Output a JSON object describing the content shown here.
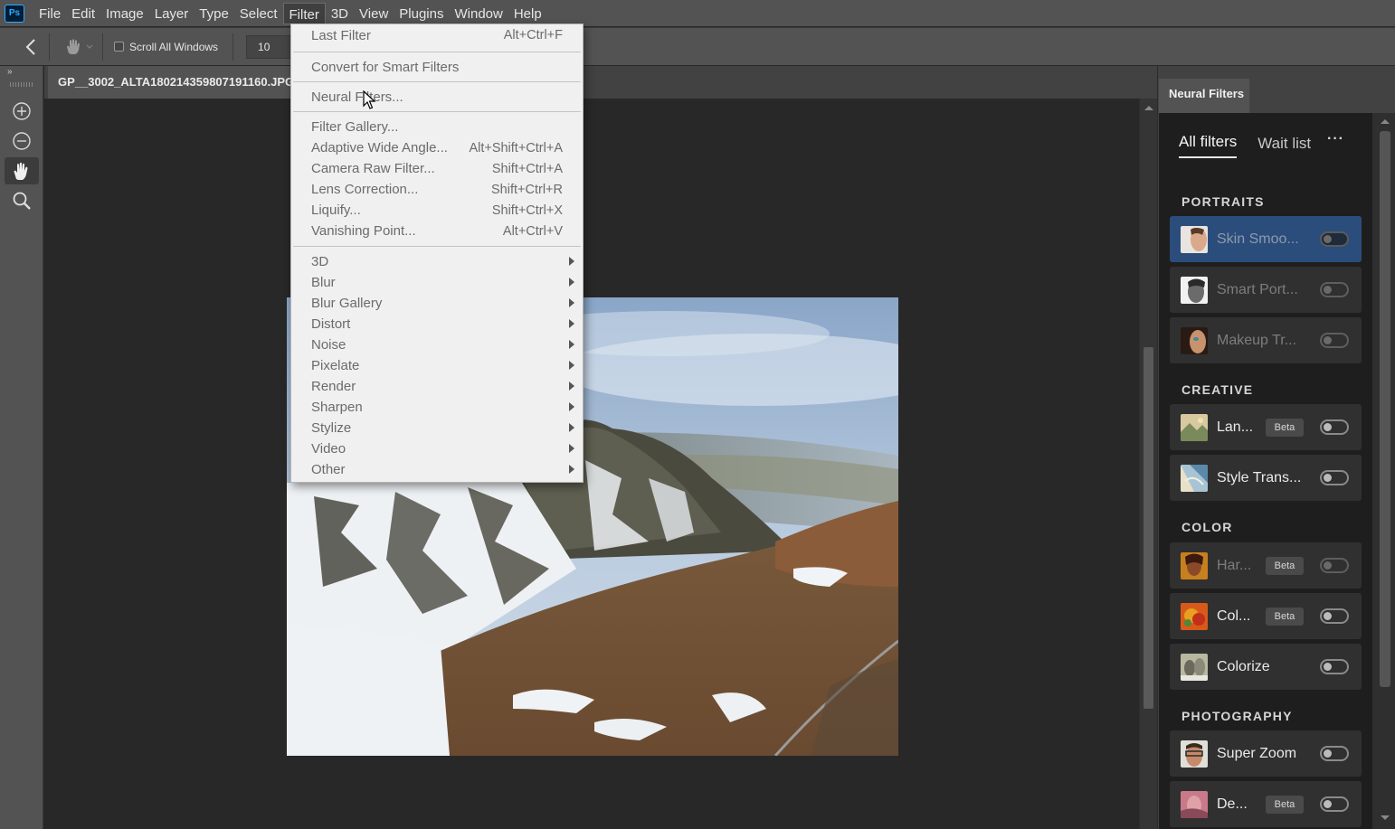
{
  "app": {
    "logo": "Ps"
  },
  "menubar": {
    "items": [
      "File",
      "Edit",
      "Image",
      "Layer",
      "Type",
      "Select",
      "Filter",
      "3D",
      "View",
      "Plugins",
      "Window",
      "Help"
    ]
  },
  "options": {
    "scroll_all_label": "Scroll All Windows",
    "zoom_value": "10"
  },
  "toolbar": {
    "collapse": "»"
  },
  "document": {
    "tab_title": "GP__3002_ALTA180214359807191160.JPG"
  },
  "filter_menu": {
    "last_filter": {
      "label": "Last Filter",
      "shortcut": "Alt+Ctrl+F"
    },
    "convert": {
      "label": "Convert for Smart Filters"
    },
    "neural": {
      "label": "Neural Filters..."
    },
    "gallery_items": [
      {
        "label": "Filter Gallery...",
        "shortcut": ""
      },
      {
        "label": "Adaptive Wide Angle...",
        "shortcut": "Alt+Shift+Ctrl+A"
      },
      {
        "label": "Camera Raw Filter...",
        "shortcut": "Shift+Ctrl+A"
      },
      {
        "label": "Lens Correction...",
        "shortcut": "Shift+Ctrl+R"
      },
      {
        "label": "Liquify...",
        "shortcut": "Shift+Ctrl+X"
      },
      {
        "label": "Vanishing Point...",
        "shortcut": "Alt+Ctrl+V"
      }
    ],
    "submenus": [
      "3D",
      "Blur",
      "Blur Gallery",
      "Distort",
      "Noise",
      "Pixelate",
      "Render",
      "Sharpen",
      "Stylize",
      "Video",
      "Other"
    ]
  },
  "neural_panel": {
    "tab": "Neural Filters",
    "tabs": [
      "All filters",
      "Wait list"
    ],
    "more": "···",
    "beta": "Beta",
    "sections": {
      "portraits": "PORTRAITS",
      "creative": "CREATIVE",
      "color": "COLOR",
      "photography": "PHOTOGRAPHY"
    },
    "filters": {
      "skin": "Skin Smoo...",
      "smart_portrait": "Smart Port...",
      "makeup": "Makeup Tr...",
      "landscape": "Lan...",
      "style_transfer": "Style Trans...",
      "harmonization": "Har...",
      "color_transfer": "Col...",
      "colorize": "Colorize",
      "super_zoom": "Super Zoom",
      "depth": "De..."
    }
  }
}
